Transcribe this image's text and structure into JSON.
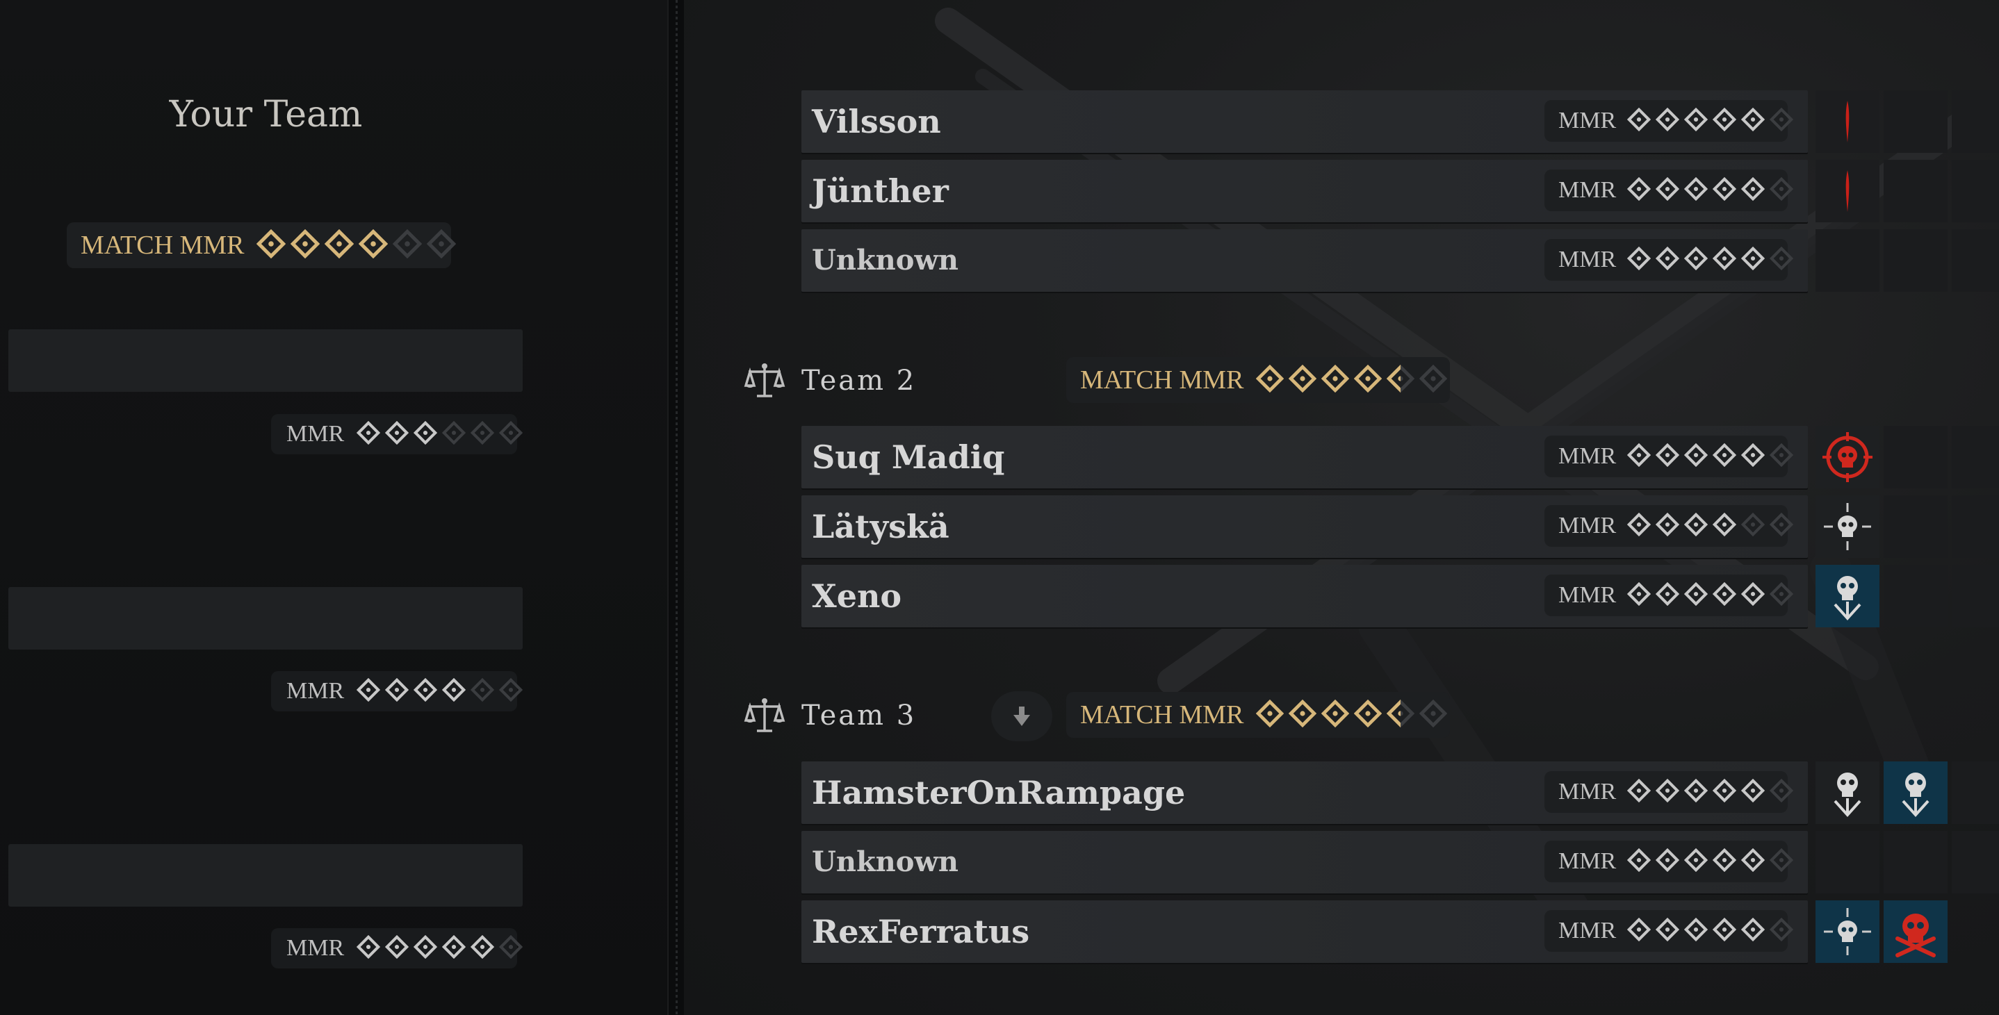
{
  "your_team": {
    "title": "Your Team",
    "match_mmr": {
      "label": "MATCH MMR",
      "stars_filled": 4,
      "stars_total": 6
    },
    "slots": [
      {
        "mmr_label": "MMR",
        "stars_filled": 3,
        "stars_total": 6
      },
      {
        "mmr_label": "MMR",
        "stars_filled": 4,
        "stars_total": 6
      },
      {
        "mmr_label": "MMR",
        "stars_filled": 5,
        "stars_total": 6
      }
    ]
  },
  "teams": [
    {
      "name": "",
      "players": [
        {
          "name": "Vilsson",
          "mmr_label": "MMR",
          "stars_filled": 5,
          "stars_total": 6
        },
        {
          "name": "Jünther",
          "mmr_label": "MMR",
          "stars_filled": 5,
          "stars_total": 6
        },
        {
          "name": "Unknown",
          "mmr_label": "MMR",
          "stars_filled": 5,
          "stars_total": 6
        }
      ]
    },
    {
      "name": "Team 2",
      "match_mmr": {
        "label": "MATCH MMR",
        "stars_filled": 4.5,
        "stars_total": 6
      },
      "players": [
        {
          "name": "Suq Madiq",
          "mmr_label": "MMR",
          "stars_filled": 5,
          "stars_total": 6
        },
        {
          "name": "Lätyskä",
          "mmr_label": "MMR",
          "stars_filled": 4,
          "stars_total": 6
        },
        {
          "name": "Xeno",
          "mmr_label": "MMR",
          "stars_filled": 5,
          "stars_total": 6
        }
      ]
    },
    {
      "name": "Team 3",
      "match_mmr": {
        "label": "MATCH MMR",
        "stars_filled": 4.5,
        "stars_total": 6
      },
      "players": [
        {
          "name": "HamsterOnRampage",
          "mmr_label": "MMR",
          "stars_filled": 5,
          "stars_total": 6
        },
        {
          "name": "Unknown",
          "mmr_label": "MMR",
          "stars_filled": 5,
          "stars_total": 6
        },
        {
          "name": "RexFerratus",
          "mmr_label": "MMR",
          "stars_filled": 5,
          "stars_total": 6
        }
      ]
    }
  ],
  "colors": {
    "gold": "#d7b77a",
    "silver": "#c8c8c8",
    "dim": "#3b3d40",
    "red": "#d0281e",
    "blue_badge": "#0f3448"
  },
  "icons": {
    "star": "diamond-star-icon",
    "balance": "balance-scale-icon",
    "kill_red": "red-skull-crosshair-icon",
    "kill_grey": "grey-skull-crosshair-icon",
    "downed": "skull-down-arrow-icon",
    "bleed": "red-blood-mark-icon",
    "skull_crossbones": "red-skull-crossbones-icon",
    "team_marker": "down-arrow-marker-icon"
  }
}
